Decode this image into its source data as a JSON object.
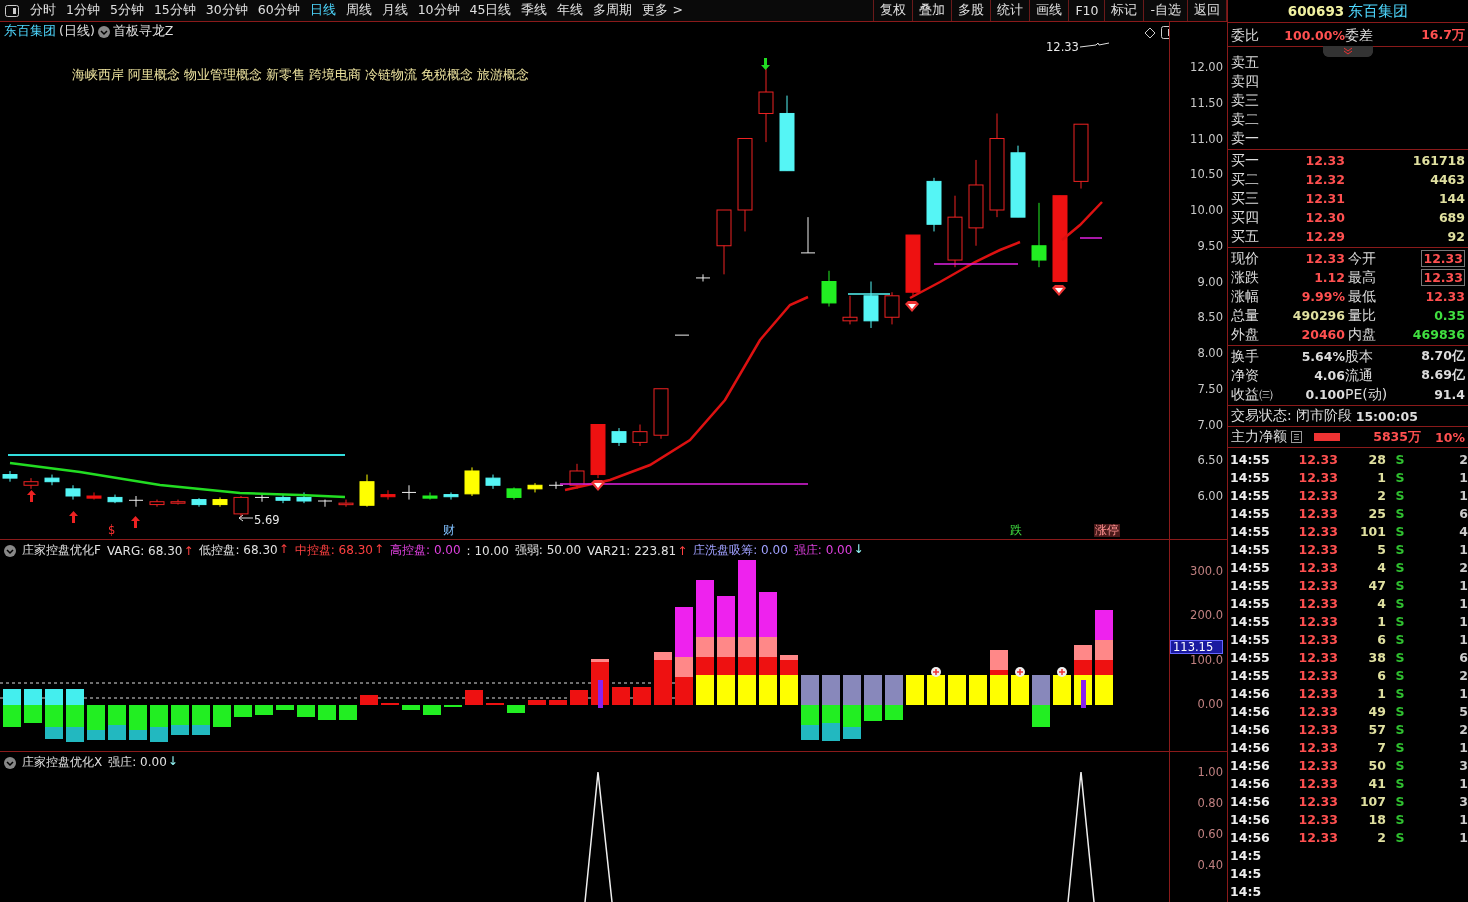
{
  "toolbar": {
    "periods": [
      {
        "label": "分时",
        "selected": false
      },
      {
        "label": "1分钟",
        "selected": false
      },
      {
        "label": "5分钟",
        "selected": false
      },
      {
        "label": "15分钟",
        "selected": false
      },
      {
        "label": "30分钟",
        "selected": false
      },
      {
        "label": "60分钟",
        "selected": false
      },
      {
        "label": "日线",
        "selected": true
      },
      {
        "label": "周线",
        "selected": false
      },
      {
        "label": "月线",
        "selected": false
      },
      {
        "label": "10分钟",
        "selected": false
      },
      {
        "label": "45日线",
        "selected": false
      },
      {
        "label": "季线",
        "selected": false
      },
      {
        "label": "年线",
        "selected": false
      },
      {
        "label": "多周期",
        "selected": false
      },
      {
        "label": "更多 >",
        "selected": false
      }
    ],
    "buttons": [
      "复权",
      "叠加",
      "多股",
      "统计",
      "画线",
      "F10",
      "标记",
      "-自选",
      "返回"
    ]
  },
  "price_chart": {
    "stock": "东百集团",
    "period": "(日线)",
    "formula": "首板寻龙Z",
    "concepts": "海峡西岸 阿里概念 物业管理概念 新零售 跨境电商 冷链物流 免税概念 旅游概念",
    "high_label": "12.33",
    "low_label": "5.69",
    "markers": [
      {
        "text": "$",
        "kind": "warn"
      },
      {
        "text": "财",
        "kind": "info"
      },
      {
        "text": "跌",
        "kind": "down"
      },
      {
        "text": "涨停",
        "kind": "limit"
      }
    ],
    "axis": [
      "12.00",
      "11.50",
      "11.00",
      "10.50",
      "10.00",
      "9.50",
      "9.00",
      "8.50",
      "8.00",
      "7.50",
      "7.00",
      "6.50",
      "6.00"
    ]
  },
  "indicator_1": {
    "name": "庄家控盘优化F",
    "values": [
      {
        "text": "VARG: 68.30",
        "arrow": "↑",
        "kind": "plain"
      },
      {
        "text": "低控盘: 68.30",
        "arrow": "↑",
        "kind": "plain"
      },
      {
        "text": "中控盘: 68.30",
        "arrow": "↑",
        "kind": "red"
      },
      {
        "text": "高控盘: 0.00",
        "kind": "magenta"
      },
      {
        "text": ": 10.00",
        "kind": "plain"
      },
      {
        "text": "强弱: 50.00",
        "kind": "plain"
      },
      {
        "text": "VAR21: 223.81",
        "arrow": "↑",
        "kind": "plain"
      },
      {
        "text": "庄洗盘吸筹: 0.00",
        "kind": "lavender"
      },
      {
        "text": "强庄: 0.00",
        "arrow": "↓",
        "kind": "magenta"
      }
    ],
    "axis": [
      "300.0",
      "200.0",
      "100.0",
      "0.00"
    ],
    "cursor_value": "113.15"
  },
  "indicator_2": {
    "name": "庄家控盘优化X",
    "values": [
      {
        "text": "强庄: 0.00",
        "arrow": "↓",
        "kind": "plain"
      }
    ],
    "axis": [
      "1.00",
      "0.80",
      "0.60",
      "0.40"
    ]
  },
  "quote": {
    "code": "600693",
    "name": "东百集团",
    "ratio": {
      "label": "委比",
      "value": "100.00%",
      "label2": "委差",
      "value2": "16.7万"
    },
    "sells": [
      {
        "label": "卖五"
      },
      {
        "label": "卖四"
      },
      {
        "label": "卖三"
      },
      {
        "label": "卖二"
      },
      {
        "label": "卖一"
      }
    ],
    "buys": [
      {
        "label": "买一",
        "price": "12.33",
        "volume": "161718"
      },
      {
        "label": "买二",
        "price": "12.32",
        "volume": "4463"
      },
      {
        "label": "买三",
        "price": "12.31",
        "volume": "144"
      },
      {
        "label": "买四",
        "price": "12.30",
        "volume": "689"
      },
      {
        "label": "买五",
        "price": "12.29",
        "volume": "92"
      }
    ],
    "stats": [
      {
        "label": "现价",
        "value": "12.33",
        "kind": "up",
        "boxed": false
      },
      {
        "label": "今开",
        "value": "12.33",
        "kind": "up",
        "boxed": true
      },
      {
        "label": "涨跌",
        "value": "1.12",
        "kind": "up",
        "boxed": false
      },
      {
        "label": "最高",
        "value": "12.33",
        "kind": "up",
        "boxed": true
      },
      {
        "label": "涨幅",
        "value": "9.99%",
        "kind": "up",
        "boxed": false
      },
      {
        "label": "最低",
        "value": "12.33",
        "kind": "up",
        "boxed": false
      },
      {
        "label": "总量",
        "value": "490296",
        "kind": "vol",
        "boxed": false
      },
      {
        "label": "量比",
        "value": "0.35",
        "kind": "down",
        "boxed": false
      },
      {
        "label": "外盘",
        "value": "20460",
        "kind": "up",
        "boxed": false
      },
      {
        "label": "内盘",
        "value": "469836",
        "kind": "down",
        "boxed": false
      }
    ],
    "finance": [
      {
        "label": "换手",
        "value": "5.64%",
        "label2": "股本",
        "value2": "8.70亿"
      },
      {
        "label": "净资",
        "value": "4.06",
        "label2": "流通",
        "value2": "8.69亿"
      },
      {
        "label": "收益㈢",
        "value": "0.100",
        "label2": "PE(动)",
        "value2": "91.4"
      }
    ],
    "status": {
      "label": "交易状态:",
      "value": "闭市阶段",
      "time": "15:00:05"
    },
    "flow": {
      "label": "主力净额",
      "value": "5835万",
      "percent": "10%"
    },
    "trades": [
      {
        "time": "14:55",
        "price": "12.33",
        "volume": "28",
        "side": "S",
        "count": "2"
      },
      {
        "time": "14:55",
        "price": "12.33",
        "volume": "1",
        "side": "S",
        "count": "1"
      },
      {
        "time": "14:55",
        "price": "12.33",
        "volume": "2",
        "side": "S",
        "count": "1"
      },
      {
        "time": "14:55",
        "price": "12.33",
        "volume": "25",
        "side": "S",
        "count": "6"
      },
      {
        "time": "14:55",
        "price": "12.33",
        "volume": "101",
        "side": "S",
        "count": "4"
      },
      {
        "time": "14:55",
        "price": "12.33",
        "volume": "5",
        "side": "S",
        "count": "1"
      },
      {
        "time": "14:55",
        "price": "12.33",
        "volume": "4",
        "side": "S",
        "count": "2"
      },
      {
        "time": "14:55",
        "price": "12.33",
        "volume": "47",
        "side": "S",
        "count": "1"
      },
      {
        "time": "14:55",
        "price": "12.33",
        "volume": "4",
        "side": "S",
        "count": "1"
      },
      {
        "time": "14:55",
        "price": "12.33",
        "volume": "1",
        "side": "S",
        "count": "1"
      },
      {
        "time": "14:55",
        "price": "12.33",
        "volume": "6",
        "side": "S",
        "count": "1"
      },
      {
        "time": "14:55",
        "price": "12.33",
        "volume": "38",
        "side": "S",
        "count": "6"
      },
      {
        "time": "14:55",
        "price": "12.33",
        "volume": "6",
        "side": "S",
        "count": "2"
      },
      {
        "time": "14:56",
        "price": "12.33",
        "volume": "1",
        "side": "S",
        "count": "1"
      },
      {
        "time": "14:56",
        "price": "12.33",
        "volume": "49",
        "side": "S",
        "count": "5"
      },
      {
        "time": "14:56",
        "price": "12.33",
        "volume": "57",
        "side": "S",
        "count": "2"
      },
      {
        "time": "14:56",
        "price": "12.33",
        "volume": "7",
        "side": "S",
        "count": "1"
      },
      {
        "time": "14:56",
        "price": "12.33",
        "volume": "50",
        "side": "S",
        "count": "3"
      },
      {
        "time": "14:56",
        "price": "12.33",
        "volume": "41",
        "side": "S",
        "count": "1"
      },
      {
        "time": "14:56",
        "price": "12.33",
        "volume": "107",
        "side": "S",
        "count": "3"
      },
      {
        "time": "14:56",
        "price": "12.33",
        "volume": "18",
        "side": "S",
        "count": "1"
      },
      {
        "time": "14:56",
        "price": "12.33",
        "volume": "2",
        "side": "S",
        "count": "1"
      },
      {
        "time": "14:5"
      },
      {
        "time": "14:5"
      },
      {
        "time": "14:5"
      }
    ]
  }
}
